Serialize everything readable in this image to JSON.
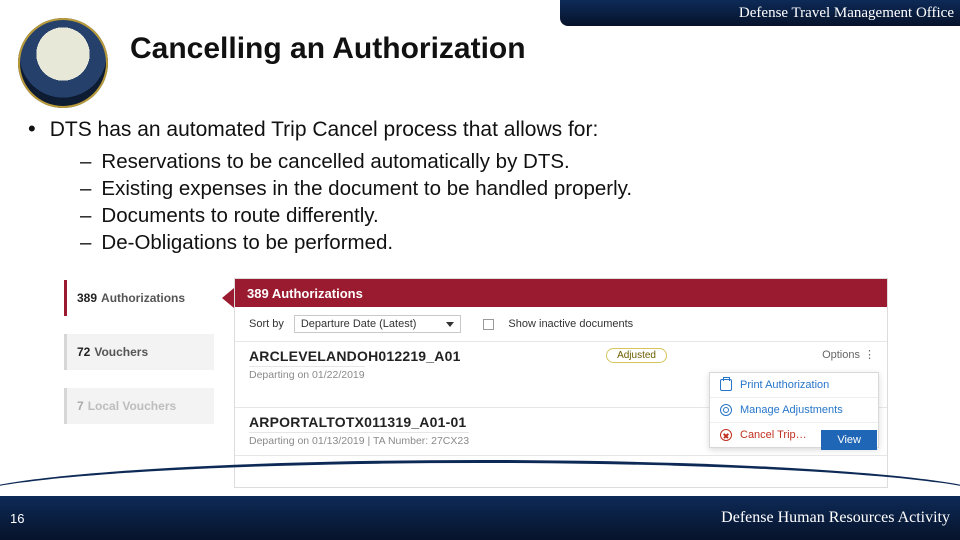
{
  "header": {
    "office": "Defense Travel Management Office"
  },
  "title": "Cancelling an Authorization",
  "lead": "DTS has an automated Trip Cancel process that allows for:",
  "sub_points": [
    "Reservations to be cancelled automatically by DTS.",
    "Existing expenses in the document to be handled properly.",
    "Documents to route differently.",
    "De-Obligations to be performed."
  ],
  "screenshot": {
    "sidebar": [
      {
        "count": "389",
        "label": "Authorizations",
        "active": true
      },
      {
        "count": "72",
        "label": "Vouchers",
        "active": false
      },
      {
        "count": "7",
        "label": "Local Vouchers",
        "active": false
      }
    ],
    "panel_title": "389 Authorizations",
    "sort_label": "Sort by",
    "sort_value": "Departure Date (Latest)",
    "show_inactive": "Show inactive documents",
    "docs": [
      {
        "name": "ARCLEVELANDOH012219_A01",
        "meta": "Departing on 01/22/2019",
        "badge": "Adjusted",
        "options": "Options"
      },
      {
        "name": "ARPORTALTOTX011319_A01-01",
        "meta": "Departing on 01/13/2019   |   TA Number: 27CX23"
      }
    ],
    "menu": {
      "print": "Print Authorization",
      "manage": "Manage Adjustments",
      "cancel": "Cancel Trip…"
    },
    "view": "View"
  },
  "footer": {
    "page": "16",
    "org": "Defense Human Resources Activity"
  }
}
